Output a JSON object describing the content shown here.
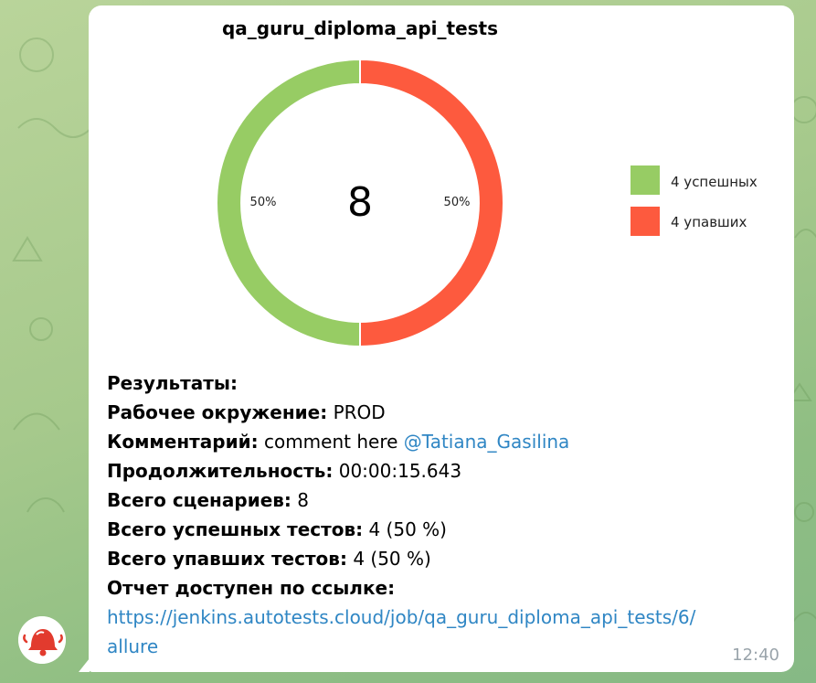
{
  "chart_data": {
    "type": "pie",
    "title": "qa_guru_diploma_api_tests",
    "center_label": "8",
    "slices": [
      {
        "label": "4 успешных",
        "value": 4,
        "percent_label": "50%",
        "color": "#97cc64"
      },
      {
        "label": "4 упавших",
        "value": 4,
        "percent_label": "50%",
        "color": "#fd5a3e"
      }
    ],
    "legend": "right"
  },
  "message": {
    "header": "Результаты:",
    "env_label": "Рабочее окружение:",
    "env_value": "PROD",
    "comment_label": "Комментарий:",
    "comment_value": "comment here",
    "comment_mention": "@Tatiana_Gasilina",
    "duration_label": "Продолжительность:",
    "duration_value": "00:00:15.643",
    "scenarios_label": "Всего сценариев:",
    "scenarios_value": "8",
    "passed_label": "Всего успешных тестов:",
    "passed_value": "4 (50 %)",
    "failed_label": "Всего упавших тестов:",
    "failed_value": "4 (50 %)",
    "report_label": "Отчет доступен по ссылке:",
    "report_link_line1": "https://jenkins.autotests.cloud/job/qa_guru_diploma_api_tests/6/",
    "report_link_line2": "allure",
    "time": "12:40"
  },
  "colors": {
    "passed": "#97cc64",
    "failed": "#fd5a3e",
    "link": "#2f86c4",
    "avatar_accent": "#e23b2e"
  },
  "icons": {
    "avatar": "bell-icon"
  }
}
